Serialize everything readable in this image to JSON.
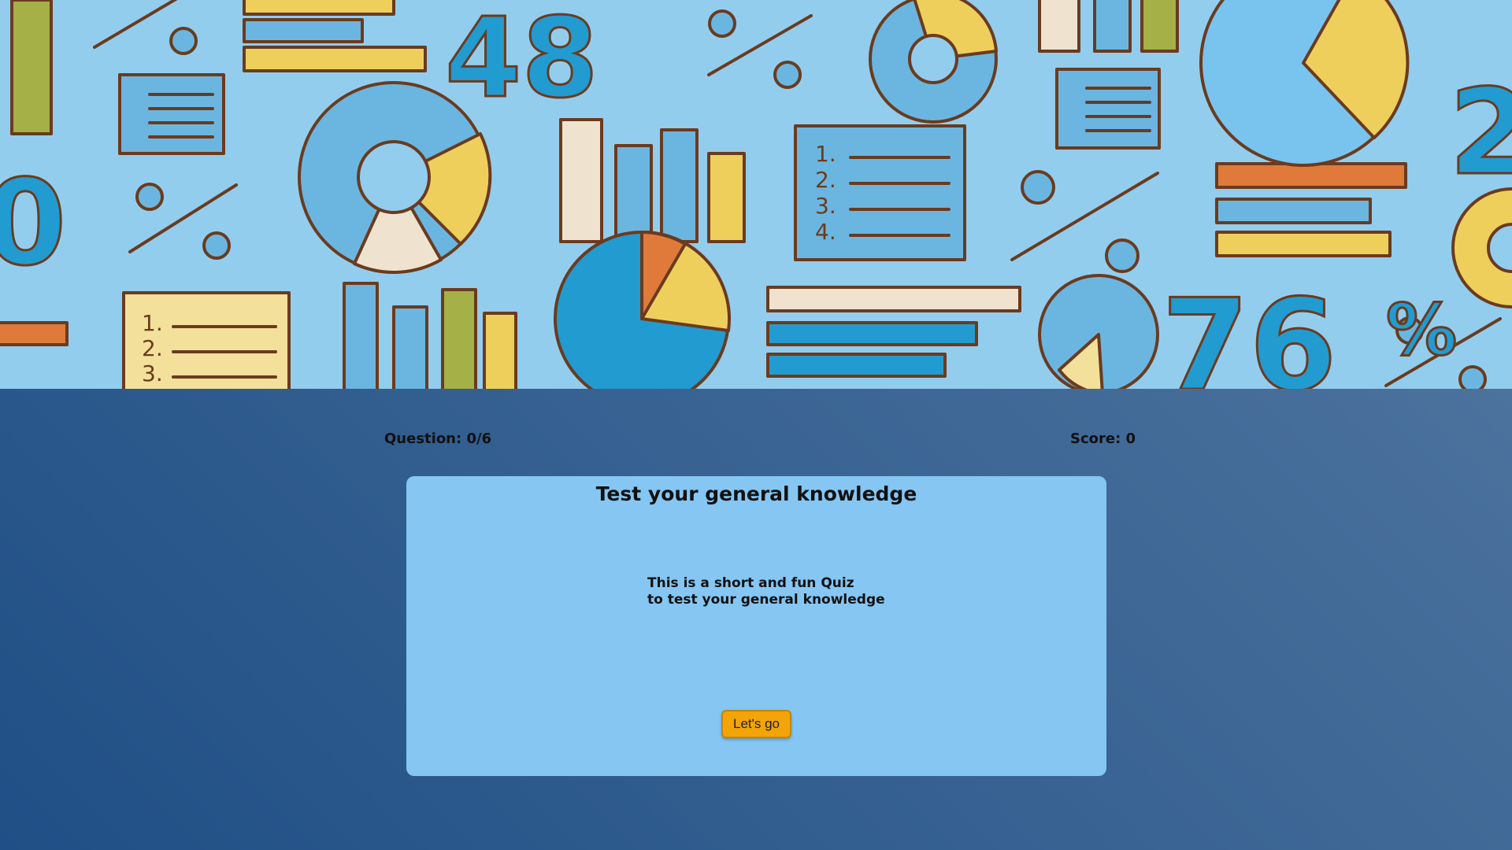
{
  "page": {
    "question_label": "Question: 0/6",
    "score_label": "Score: 0"
  },
  "hero": {
    "art_numbers": [
      "48",
      "%",
      "76",
      "%",
      "2",
      "0",
      "%"
    ],
    "list_numbers": [
      "1.",
      "2.",
      "3.",
      "4."
    ],
    "palette": {
      "background": "#93cdee",
      "blue": "#229bd0",
      "light_blue": "#6bb6e0",
      "yellow": "#efcf5c",
      "orange": "#e07a3b",
      "cream": "#efe3d0",
      "green": "#a5b047",
      "outline": "#6a3b1f"
    }
  },
  "card": {
    "title": "Test your general knowledge",
    "description_line1": "This is a short and fun Quiz",
    "description_line2": "to test your general knowledge",
    "button_label": "Let's go"
  },
  "colors": {
    "card_background": "#85c6f3",
    "button": "#f2a408",
    "page_gradient_start": "#5579a3",
    "page_gradient_end": "#1f4f86"
  }
}
